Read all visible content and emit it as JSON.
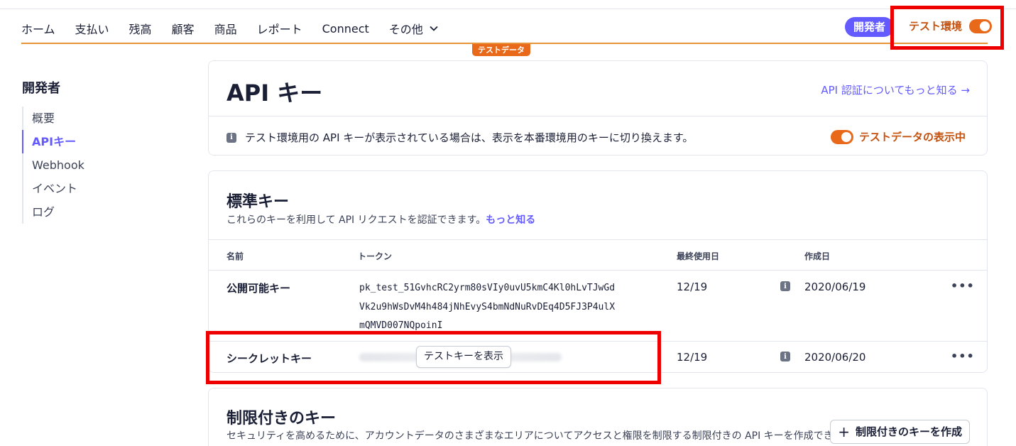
{
  "nav": {
    "items": [
      "ホーム",
      "支払い",
      "残高",
      "顧客",
      "商品",
      "レポート",
      "Connect",
      "その他"
    ],
    "developer_pill": "開発者",
    "env_label": "テスト環境",
    "test_badge": "テストデータ"
  },
  "sidebar": {
    "title": "開発者",
    "items": [
      "概要",
      "APIキー",
      "Webhook",
      "イベント",
      "ログ"
    ],
    "active_index": 1
  },
  "header_card": {
    "title": "API キー",
    "learn_link": "API 認証についてもっと知る →",
    "info_text": "テスト環境用の API キーが表示されている場合は、表示を本番環境用のキーに切り換えます。",
    "toggle_label": "テストデータの表示中"
  },
  "standard_keys": {
    "title": "標準キー",
    "subtitle": "これらのキーを利用して API リクエストを認証できます。",
    "subtitle_link": "もっと知る",
    "columns": [
      "名前",
      "トークン",
      "最終使用日",
      "作成日"
    ],
    "rows": [
      {
        "name": "公開可能キー",
        "token_lines": [
          "pk_test_51GvhcRC2yrm80sVIy0uvU5kmC4Kl0hLvTJwGd",
          "Vk2u9hWsDvM4h484jNhEvyS4bmNdNuRvDEq4D5FJ3P4ulX",
          "mQMVD007NQpoinI"
        ],
        "last_used": "12/19",
        "created": "2020/06/19"
      },
      {
        "name": "シークレットキー",
        "reveal_label": "テストキーを表示",
        "last_used": "12/19",
        "created": "2020/06/20"
      }
    ],
    "more_label": "•••"
  },
  "restricted_keys": {
    "title": "制限付きのキー",
    "subtitle": "セキュリティを高めるために、アカウントデータのさまざまなエリアについてアクセスと権限を制限する制限付きの API キーを作成できま",
    "create_label": "制限付きのキーを作成"
  },
  "colors": {
    "accent": "#635bff",
    "test_orange": "#e8691a",
    "highlight_red": "#ee0000"
  }
}
